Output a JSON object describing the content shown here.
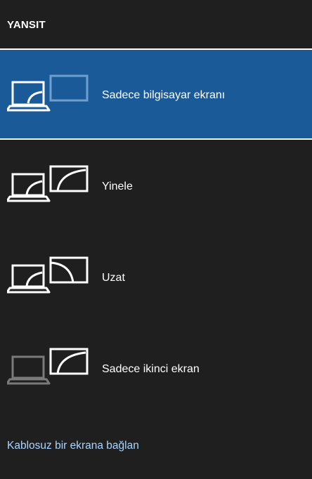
{
  "header": {
    "title": "YANSIT"
  },
  "options": [
    {
      "label": "Sadece bilgisayar ekranı",
      "icon": "pc-screen-only-icon",
      "selected": true
    },
    {
      "label": "Yinele",
      "icon": "duplicate-icon",
      "selected": false
    },
    {
      "label": "Uzat",
      "icon": "extend-icon",
      "selected": false
    },
    {
      "label": "Sadece ikinci ekran",
      "icon": "second-screen-only-icon",
      "selected": false
    }
  ],
  "footer": {
    "connect_link": "Kablosuz bir ekrana bağlan"
  },
  "colors": {
    "background": "#1f1f1f",
    "selected": "#1a5a99",
    "link": "#a9d6ff",
    "dimmed_icon": "#7a7a7a",
    "monitor_dim": "#6e9fce"
  }
}
